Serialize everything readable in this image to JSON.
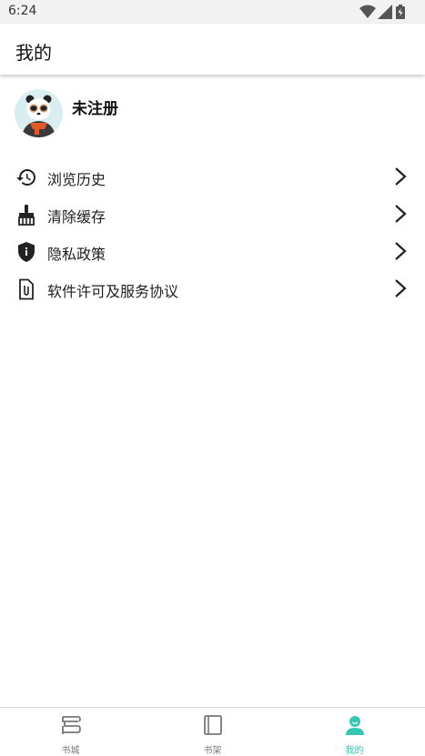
{
  "status_bar": {
    "time": "6:24"
  },
  "app_bar": {
    "title": "我的"
  },
  "profile": {
    "username": "未注册"
  },
  "menu": {
    "items": [
      {
        "label": "浏览历史",
        "icon": "history-icon"
      },
      {
        "label": "清除缓存",
        "icon": "broom-icon"
      },
      {
        "label": "隐私政策",
        "icon": "shield-icon"
      },
      {
        "label": "软件许可及服务协议",
        "icon": "document-icon"
      }
    ]
  },
  "bottom_nav": {
    "items": [
      {
        "label": "书城",
        "icon": "bookstore-icon"
      },
      {
        "label": "书架",
        "icon": "bookshelf-icon"
      },
      {
        "label": "我的",
        "icon": "person-icon",
        "active": true
      }
    ]
  },
  "colors": {
    "accent": "#35c7b4",
    "text": "#1f1f1f",
    "inactive": "#7a7a7a"
  }
}
